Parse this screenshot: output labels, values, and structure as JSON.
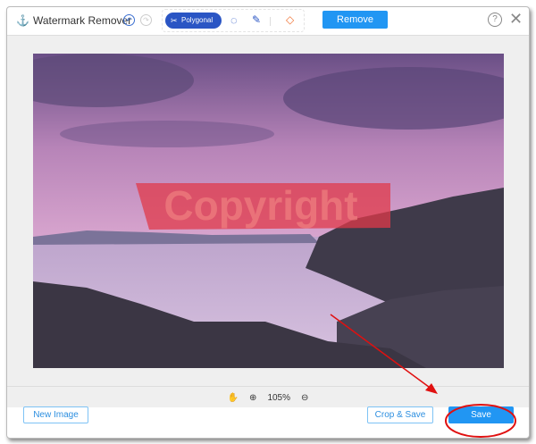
{
  "app": {
    "title": "Watermark Remover",
    "icon": "watermark-icon"
  },
  "toolbar": {
    "undo": "undo-icon",
    "redo": "redo-icon",
    "polygonal_label": "Polygonal",
    "lasso": "lasso-icon",
    "brush": "brush-icon",
    "eraser": "eraser-icon",
    "remove_label": "Remove",
    "help": "help-icon",
    "close": "close-icon"
  },
  "canvas": {
    "watermark_text": "Copyright"
  },
  "zoom": {
    "hand": "hand-icon",
    "zoom_in": "zoom-in-icon",
    "level": "105%",
    "zoom_out": "zoom-out-icon"
  },
  "footer": {
    "new_image_label": "New Image",
    "crop_save_label": "Crop & Save",
    "save_label": "Save"
  },
  "colors": {
    "accent": "#2196f3",
    "polygonal": "#2a55c4",
    "annotation": "#e01010"
  }
}
